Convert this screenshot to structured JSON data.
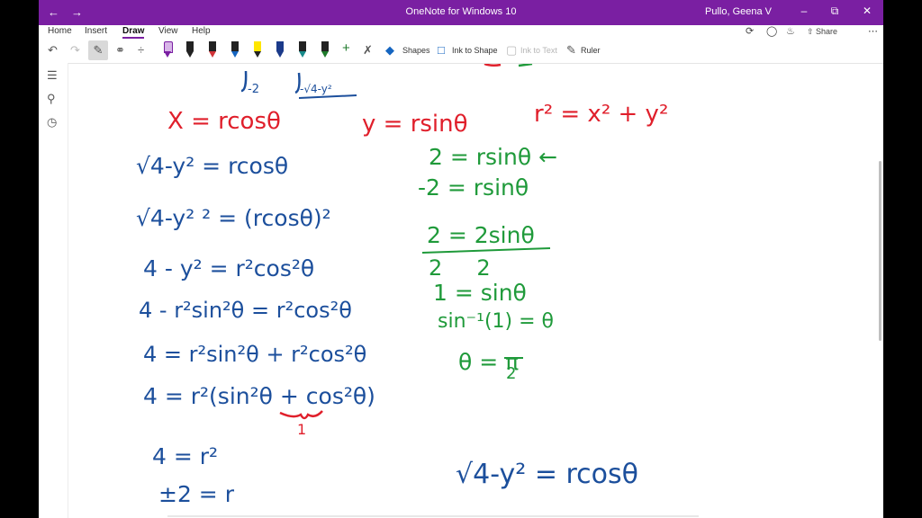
{
  "window": {
    "title": "OneNote for Windows 10",
    "user": "Pullo, Geena V",
    "back_icon": "arrow-left",
    "forward_icon": "arrow-right"
  },
  "ribbon": {
    "tabs": [
      {
        "label": "Home"
      },
      {
        "label": "Insert"
      },
      {
        "label": "Draw",
        "active": true
      },
      {
        "label": "View"
      },
      {
        "label": "Help"
      }
    ],
    "share_label": "Share"
  },
  "draw_toolbar": {
    "shapes_label": "Shapes",
    "ink_to_shape_label": "Ink to Shape",
    "ink_to_text_label": "Ink to Text",
    "ruler_label": "Ruler",
    "pen_colors": [
      "#2b2b2b",
      "#2b2b2b",
      "#d13438",
      "#1565c0",
      "#ffe600",
      "#1b3a8a",
      "#188a8a",
      "#1e7a2b"
    ]
  },
  "colors": {
    "title_bar": "#7a1fa2",
    "ink_red": "#e01f2b",
    "ink_blue": "#1c4f9c",
    "ink_green": "#1f9a3a"
  },
  "notes": {
    "top_limits": [
      "-2",
      "-√4-y²"
    ],
    "red": [
      "X = rcosθ",
      "y = rsinθ",
      "r² = x² + y²"
    ],
    "blue": [
      "√4-y² = rcosθ",
      "√4-y² ² = (rcosθ)²",
      "4 - y² = r²cos²θ",
      "4 - r²sin²θ = r²cos²θ",
      "4 = r²sin²θ + r²cos²θ",
      "4 = r²(sin²θ + cos²θ)",
      "4 = r²",
      "±2 = r",
      "√4-y² = rcosθ"
    ],
    "brace_label": "1",
    "green": [
      "2 = rsinθ ←",
      "-2 = rsinθ",
      "2 = 2sinθ",
      "2     2",
      "1 = sinθ",
      "sin⁻¹(1) = θ",
      "θ = π",
      "2"
    ]
  }
}
